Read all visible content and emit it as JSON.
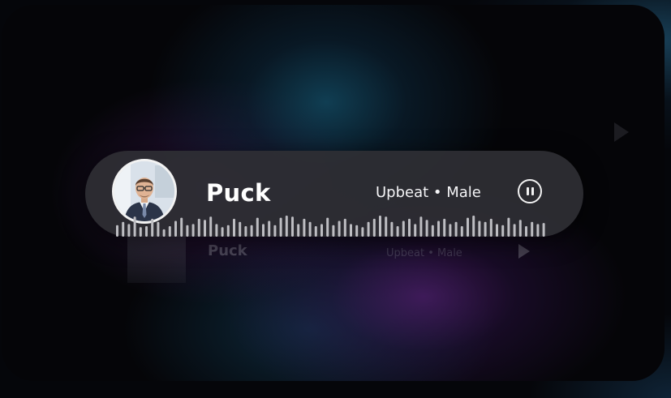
{
  "player": {
    "name": "Puck",
    "tags": "Upbeat • Male",
    "avatar_icon": "person-avatar",
    "pause_icon": "pause-icon",
    "state": "playing"
  },
  "background_item": {
    "name": "Puck",
    "tags": "Upbeat • Male",
    "action_icon": "play-icon"
  },
  "waveform": {
    "bar_color": "#bdbdc2",
    "levels": [
      0.55,
      0.7,
      0.6,
      0.95,
      0.45,
      0.5,
      0.85,
      0.7,
      0.35,
      0.5,
      0.75,
      0.9,
      0.55,
      0.6,
      0.85,
      0.8,
      0.95,
      0.6,
      0.45,
      0.55,
      0.85,
      0.7,
      0.5,
      0.55,
      0.9,
      0.6,
      0.75,
      0.55,
      0.9,
      1.0,
      0.95,
      0.6,
      0.85,
      0.7,
      0.5,
      0.6,
      0.9,
      0.55,
      0.75,
      0.85,
      0.6,
      0.55,
      0.45,
      0.7,
      0.85,
      1.0,
      0.95,
      0.7,
      0.5,
      0.75,
      0.85,
      0.6,
      0.95,
      0.8,
      0.55,
      0.75,
      0.85,
      0.6,
      0.7,
      0.5,
      0.9,
      1.0,
      0.75,
      0.7,
      0.85,
      0.6,
      0.55,
      0.9,
      0.6,
      0.8,
      0.5,
      0.7,
      0.6,
      0.65
    ]
  },
  "colors": {
    "player_bg": "#2e2e34",
    "text": "#ffffff",
    "accent_purple": "#5a2380",
    "accent_teal": "#124860"
  }
}
